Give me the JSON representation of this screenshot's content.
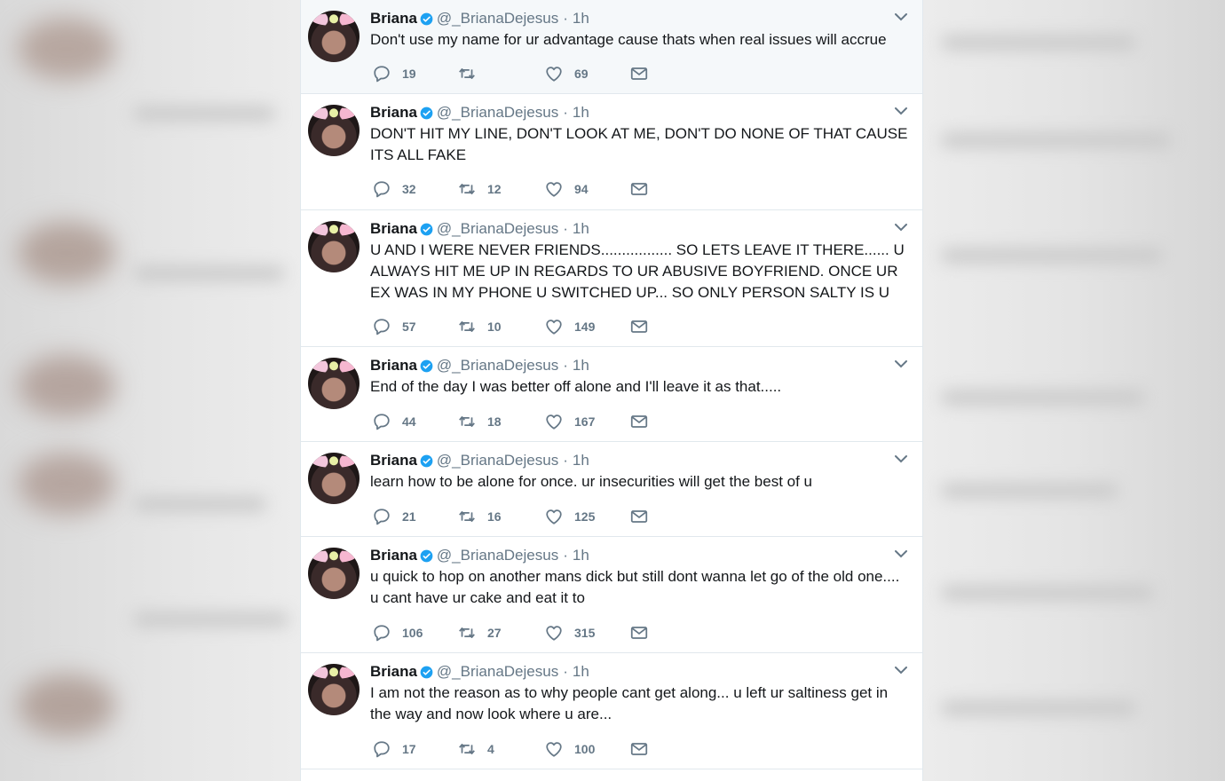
{
  "user": {
    "display_name": "Briana",
    "handle": "@_BrianaDejesus",
    "separator": "·",
    "verified_icon": "verified-badge-icon"
  },
  "colors": {
    "text": "#14171a",
    "muted": "#657786",
    "verified": "#1da1f2",
    "highlight_bg": "#f5f8fa",
    "border": "#e1e8ed"
  },
  "tweets": [
    {
      "time": "1h",
      "text": "Don't use my name for ur advantage cause thats when real issues will accrue",
      "replies": "19",
      "retweets": "",
      "likes": "69"
    },
    {
      "time": "1h",
      "text": "DON'T HIT MY LINE, DON'T LOOK AT ME, DON'T DO NONE OF THAT CAUSE ITS ALL FAKE",
      "replies": "32",
      "retweets": "12",
      "likes": "94"
    },
    {
      "time": "1h",
      "text": "U AND I WERE NEVER FRIENDS................. SO LETS LEAVE IT THERE...... U ALWAYS HIT ME UP IN REGARDS TO UR ABUSIVE BOYFRIEND. ONCE UR EX WAS IN MY PHONE U SWITCHED UP... SO ONLY PERSON SALTY IS U",
      "replies": "57",
      "retweets": "10",
      "likes": "149"
    },
    {
      "time": "1h",
      "text": "End of the day I was better off alone and I'll leave it as that.....",
      "replies": "44",
      "retweets": "18",
      "likes": "167"
    },
    {
      "time": "1h",
      "text": "learn how to be alone for once. ur insecurities will get the best of u",
      "replies": "21",
      "retweets": "16",
      "likes": "125"
    },
    {
      "time": "1h",
      "text": "u quick to hop on another mans dick but still dont wanna let go of the old one.... u cant have ur cake and eat it to",
      "replies": "106",
      "retweets": "27",
      "likes": "315"
    },
    {
      "time": "1h",
      "text": "I am not the reason as to why people cant get along... u left ur saltiness get in the way and now look where u are...",
      "replies": "17",
      "retweets": "4",
      "likes": "100"
    }
  ]
}
